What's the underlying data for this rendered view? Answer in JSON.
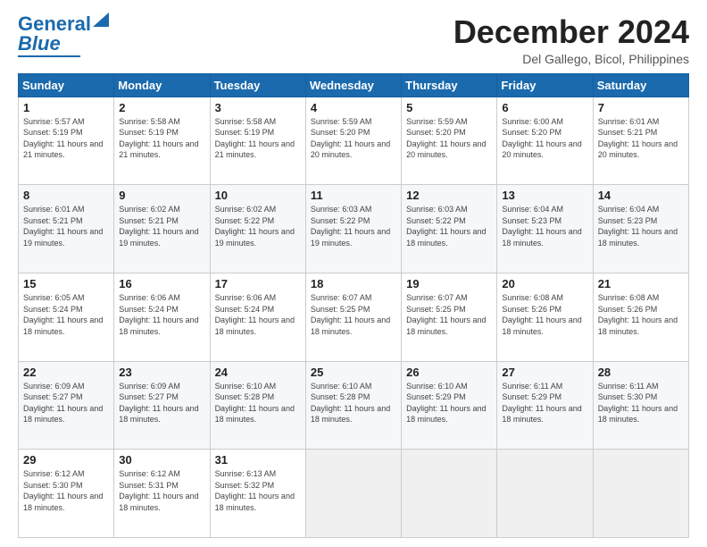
{
  "header": {
    "logo_text1": "General",
    "logo_text2": "Blue",
    "month_title": "December 2024",
    "location": "Del Gallego, Bicol, Philippines"
  },
  "weekdays": [
    "Sunday",
    "Monday",
    "Tuesday",
    "Wednesday",
    "Thursday",
    "Friday",
    "Saturday"
  ],
  "weeks": [
    [
      {
        "day": "1",
        "sunrise": "5:57 AM",
        "sunset": "5:19 PM",
        "daylight": "11 hours and 21 minutes."
      },
      {
        "day": "2",
        "sunrise": "5:58 AM",
        "sunset": "5:19 PM",
        "daylight": "11 hours and 21 minutes."
      },
      {
        "day": "3",
        "sunrise": "5:58 AM",
        "sunset": "5:19 PM",
        "daylight": "11 hours and 21 minutes."
      },
      {
        "day": "4",
        "sunrise": "5:59 AM",
        "sunset": "5:20 PM",
        "daylight": "11 hours and 20 minutes."
      },
      {
        "day": "5",
        "sunrise": "5:59 AM",
        "sunset": "5:20 PM",
        "daylight": "11 hours and 20 minutes."
      },
      {
        "day": "6",
        "sunrise": "6:00 AM",
        "sunset": "5:20 PM",
        "daylight": "11 hours and 20 minutes."
      },
      {
        "day": "7",
        "sunrise": "6:01 AM",
        "sunset": "5:21 PM",
        "daylight": "11 hours and 20 minutes."
      }
    ],
    [
      {
        "day": "8",
        "sunrise": "6:01 AM",
        "sunset": "5:21 PM",
        "daylight": "11 hours and 19 minutes."
      },
      {
        "day": "9",
        "sunrise": "6:02 AM",
        "sunset": "5:21 PM",
        "daylight": "11 hours and 19 minutes."
      },
      {
        "day": "10",
        "sunrise": "6:02 AM",
        "sunset": "5:22 PM",
        "daylight": "11 hours and 19 minutes."
      },
      {
        "day": "11",
        "sunrise": "6:03 AM",
        "sunset": "5:22 PM",
        "daylight": "11 hours and 19 minutes."
      },
      {
        "day": "12",
        "sunrise": "6:03 AM",
        "sunset": "5:22 PM",
        "daylight": "11 hours and 18 minutes."
      },
      {
        "day": "13",
        "sunrise": "6:04 AM",
        "sunset": "5:23 PM",
        "daylight": "11 hours and 18 minutes."
      },
      {
        "day": "14",
        "sunrise": "6:04 AM",
        "sunset": "5:23 PM",
        "daylight": "11 hours and 18 minutes."
      }
    ],
    [
      {
        "day": "15",
        "sunrise": "6:05 AM",
        "sunset": "5:24 PM",
        "daylight": "11 hours and 18 minutes."
      },
      {
        "day": "16",
        "sunrise": "6:06 AM",
        "sunset": "5:24 PM",
        "daylight": "11 hours and 18 minutes."
      },
      {
        "day": "17",
        "sunrise": "6:06 AM",
        "sunset": "5:24 PM",
        "daylight": "11 hours and 18 minutes."
      },
      {
        "day": "18",
        "sunrise": "6:07 AM",
        "sunset": "5:25 PM",
        "daylight": "11 hours and 18 minutes."
      },
      {
        "day": "19",
        "sunrise": "6:07 AM",
        "sunset": "5:25 PM",
        "daylight": "11 hours and 18 minutes."
      },
      {
        "day": "20",
        "sunrise": "6:08 AM",
        "sunset": "5:26 PM",
        "daylight": "11 hours and 18 minutes."
      },
      {
        "day": "21",
        "sunrise": "6:08 AM",
        "sunset": "5:26 PM",
        "daylight": "11 hours and 18 minutes."
      }
    ],
    [
      {
        "day": "22",
        "sunrise": "6:09 AM",
        "sunset": "5:27 PM",
        "daylight": "11 hours and 18 minutes."
      },
      {
        "day": "23",
        "sunrise": "6:09 AM",
        "sunset": "5:27 PM",
        "daylight": "11 hours and 18 minutes."
      },
      {
        "day": "24",
        "sunrise": "6:10 AM",
        "sunset": "5:28 PM",
        "daylight": "11 hours and 18 minutes."
      },
      {
        "day": "25",
        "sunrise": "6:10 AM",
        "sunset": "5:28 PM",
        "daylight": "11 hours and 18 minutes."
      },
      {
        "day": "26",
        "sunrise": "6:10 AM",
        "sunset": "5:29 PM",
        "daylight": "11 hours and 18 minutes."
      },
      {
        "day": "27",
        "sunrise": "6:11 AM",
        "sunset": "5:29 PM",
        "daylight": "11 hours and 18 minutes."
      },
      {
        "day": "28",
        "sunrise": "6:11 AM",
        "sunset": "5:30 PM",
        "daylight": "11 hours and 18 minutes."
      }
    ],
    [
      {
        "day": "29",
        "sunrise": "6:12 AM",
        "sunset": "5:30 PM",
        "daylight": "11 hours and 18 minutes."
      },
      {
        "day": "30",
        "sunrise": "6:12 AM",
        "sunset": "5:31 PM",
        "daylight": "11 hours and 18 minutes."
      },
      {
        "day": "31",
        "sunrise": "6:13 AM",
        "sunset": "5:32 PM",
        "daylight": "11 hours and 18 minutes."
      },
      null,
      null,
      null,
      null
    ]
  ],
  "labels": {
    "sunrise_prefix": "Sunrise: ",
    "sunset_prefix": "Sunset: ",
    "daylight_prefix": "Daylight: "
  }
}
